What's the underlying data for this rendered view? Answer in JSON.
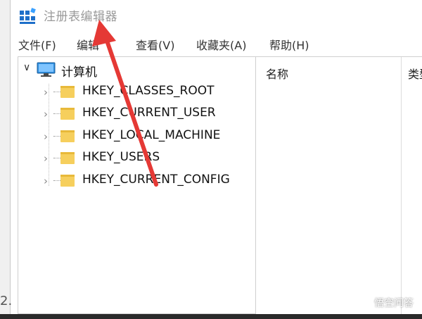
{
  "window": {
    "title": "注册表编辑器"
  },
  "menu": [
    {
      "label": "文件(F)"
    },
    {
      "label": "编辑"
    },
    {
      "label": "查看(V)"
    },
    {
      "label": "收藏夹(A)"
    },
    {
      "label": "帮助(H)"
    }
  ],
  "tree": {
    "root_label": "计算机",
    "root_toggle": "∨",
    "items": [
      {
        "label": "HKEY_CLASSES_ROOT"
      },
      {
        "label": "HKEY_CURRENT_USER"
      },
      {
        "label": "HKEY_LOCAL_MACHINE"
      },
      {
        "label": "HKEY_USERS"
      },
      {
        "label": "HKEY_CURRENT_CONFIG"
      }
    ],
    "chevron": "›"
  },
  "value_pane": {
    "col_name": "名称",
    "col_type": "类型"
  },
  "edge_glyph": "2.",
  "watermark": {
    "text": "悟空问答"
  },
  "colors": {
    "arrow": "#e53935",
    "folder": "#f6cf5d",
    "app_icon": "#1e6fc9",
    "title_text": "#9a9a9a"
  },
  "icons": {
    "app": "regedit-icon",
    "root": "computer-icon",
    "folder": "folder-icon",
    "chevron": "chevron-right-icon",
    "root_toggle": "chevron-down-icon"
  }
}
